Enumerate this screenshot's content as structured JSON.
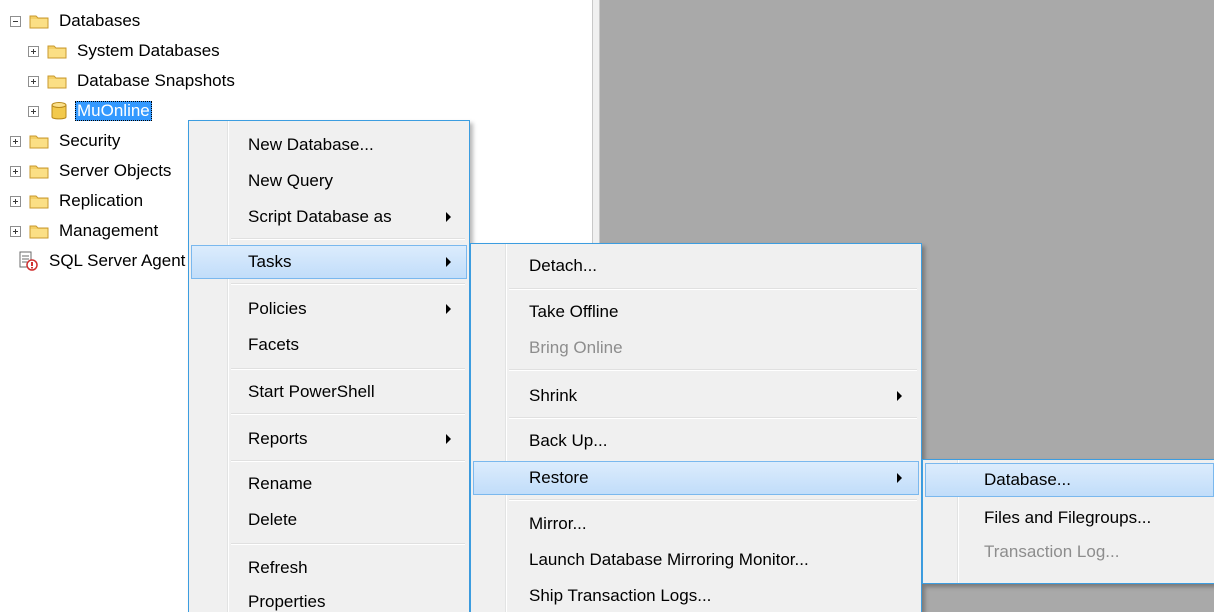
{
  "tree": {
    "items": [
      {
        "label": "Databases"
      },
      {
        "label": "System Databases"
      },
      {
        "label": "Database Snapshots"
      },
      {
        "label": "MuOnline"
      },
      {
        "label": "Security"
      },
      {
        "label": "Server Objects"
      },
      {
        "label": "Replication"
      },
      {
        "label": "Management"
      },
      {
        "label": "SQL Server Agent"
      }
    ]
  },
  "menu1": {
    "items": [
      {
        "label": "New Database..."
      },
      {
        "label": "New Query"
      },
      {
        "label": "Script Database as"
      },
      {
        "label": "Tasks"
      },
      {
        "label": "Policies"
      },
      {
        "label": "Facets"
      },
      {
        "label": "Start PowerShell"
      },
      {
        "label": "Reports"
      },
      {
        "label": "Rename"
      },
      {
        "label": "Delete"
      },
      {
        "label": "Refresh"
      },
      {
        "label": "Properties"
      }
    ]
  },
  "menu2": {
    "items": [
      {
        "label": "Detach..."
      },
      {
        "label": "Take Offline"
      },
      {
        "label": "Bring Online"
      },
      {
        "label": "Shrink"
      },
      {
        "label": "Back Up..."
      },
      {
        "label": "Restore"
      },
      {
        "label": "Mirror..."
      },
      {
        "label": "Launch Database Mirroring Monitor..."
      },
      {
        "label": "Ship Transaction Logs..."
      }
    ]
  },
  "menu3": {
    "items": [
      {
        "label": "Database..."
      },
      {
        "label": "Files and Filegroups..."
      },
      {
        "label": "Transaction Log..."
      }
    ]
  },
  "colors": {
    "selection": "#3399ff",
    "menu_highlight": "#c1ddfa",
    "menu_border": "#3c9de0",
    "document_background": "#a9a9a9"
  }
}
